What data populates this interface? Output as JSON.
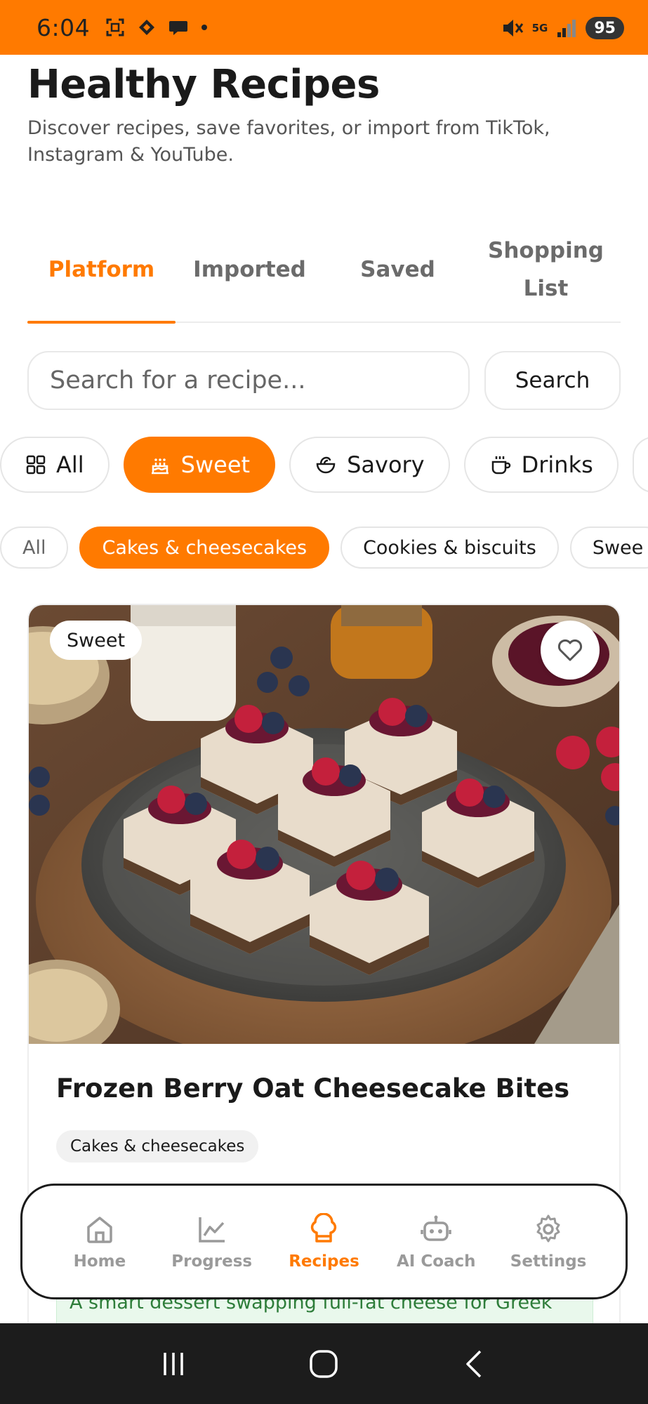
{
  "status_bar": {
    "time": "6:04",
    "battery": "95",
    "network": "5G",
    "icons": [
      "screenshot-icon",
      "diamond-icon",
      "chat-icon",
      "dot-icon",
      "mute-icon",
      "signal-icon",
      "battery-icon"
    ]
  },
  "header": {
    "title": "Healthy Recipes",
    "subtitle": "Discover recipes, save favorites, or import from TikTok, Instagram & YouTube."
  },
  "tabs": [
    {
      "label": "Platform",
      "active": true
    },
    {
      "label": "Imported",
      "active": false
    },
    {
      "label": "Saved",
      "active": false
    },
    {
      "label": "Shopping List",
      "active": false
    }
  ],
  "search": {
    "placeholder": "Search for a recipe...",
    "value": "",
    "button_label": "Search"
  },
  "categories": [
    {
      "label": "All",
      "icon": "grid-icon",
      "active": false
    },
    {
      "label": "Sweet",
      "icon": "cake-icon",
      "active": true
    },
    {
      "label": "Savory",
      "icon": "bowl-icon",
      "active": false
    },
    {
      "label": "Drinks",
      "icon": "cup-icon",
      "active": false
    }
  ],
  "subcategories": [
    {
      "label": "All",
      "active": false
    },
    {
      "label": "Cakes & cheesecakes",
      "active": true
    },
    {
      "label": "Cookies & biscuits",
      "active": false
    },
    {
      "label": "Swee",
      "active": false
    }
  ],
  "recipe": {
    "badge": "Sweet",
    "title": "Frozen Berry Oat Cheesecake Bites",
    "tag": "Cakes & cheesecakes",
    "description": "A smart dessert swapping full-fat cheese for Greek"
  },
  "bottom_nav": [
    {
      "label": "Home",
      "icon": "home-icon",
      "active": false
    },
    {
      "label": "Progress",
      "icon": "chart-icon",
      "active": false
    },
    {
      "label": "Recipes",
      "icon": "chef-hat-icon",
      "active": true
    },
    {
      "label": "AI Coach",
      "icon": "robot-icon",
      "active": false
    },
    {
      "label": "Settings",
      "icon": "gear-icon",
      "active": false
    }
  ],
  "colors": {
    "accent": "#ff7a00",
    "text": "#1a1a1a",
    "muted": "#9a9a9a"
  }
}
